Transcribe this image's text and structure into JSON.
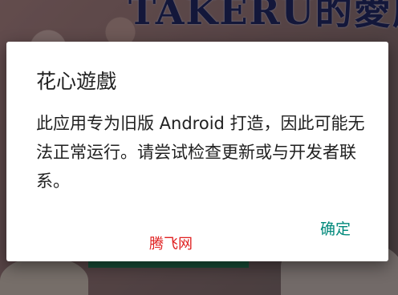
{
  "background": {
    "title_text": "TAKERU的愛慮"
  },
  "dialog": {
    "title": "花心遊戲",
    "message": "此应用专为旧版 Android 打造，因此可能无法正常运行。请尝试检查更新或与开发者联系。",
    "ok_label": "确定"
  },
  "watermark": "腾飞网",
  "colors": {
    "accent": "#00897b",
    "watermark": "#e02020",
    "text": "#212121"
  }
}
